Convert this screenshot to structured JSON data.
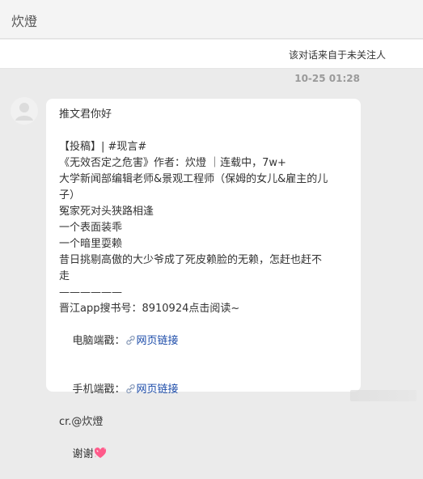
{
  "header": {
    "title": "炊燈"
  },
  "notice": {
    "text": "该对话来自于未关注人"
  },
  "message": {
    "timestamp": "10-25 01:28",
    "lines": [
      "推文君你好",
      "",
      "【投稿】| #现言#",
      "《无效否定之危害》作者：炊燈 ｜连载中，7w+",
      "大学新闻部编辑老师&景观工程师（保姆的女儿&雇主的儿",
      "子）",
      "冤家死对头狭路相逢",
      "一个表面装乖",
      "一个暗里耍赖",
      "昔日挑剔高傲的大少爷成了死皮赖脸的无赖，怎赶也赶不",
      "走",
      "——————",
      "晋江app搜书号：8910924点击阅读~"
    ],
    "pc_label": "电脑端戳：",
    "pc_link": "网页链接",
    "mobile_label": "手机端戳：",
    "mobile_link": "网页链接",
    "credit": "cr.@炊燈",
    "thanks": "谢谢"
  },
  "icons": {
    "avatar": "default-avatar-icon",
    "link": "link-icon",
    "heart": "sparkling-heart-icon"
  },
  "colors": {
    "link": "#1a4aa8",
    "background": "#ebebeb",
    "bubble": "#ffffff"
  }
}
